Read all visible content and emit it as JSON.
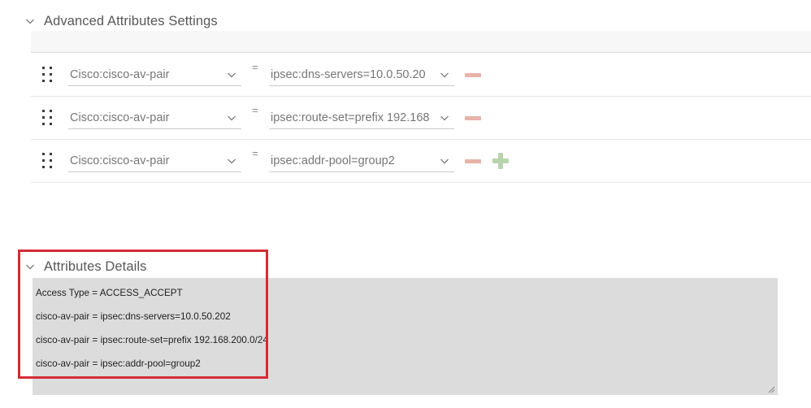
{
  "advanced_section": {
    "title": "Advanced Attributes Settings",
    "chevron_icon": "chevron-down-icon",
    "equals_symbol": "=",
    "rows": [
      {
        "drag_icon": "drag-handle-icon",
        "name": "Cisco:cisco-av-pair",
        "value": "ipsec:dns-servers=10.0.50.20",
        "remove_icon": "minus-icon",
        "add_icon": null
      },
      {
        "drag_icon": "drag-handle-icon",
        "name": "Cisco:cisco-av-pair",
        "value": "ipsec:route-set=prefix 192.168",
        "remove_icon": "minus-icon",
        "add_icon": null
      },
      {
        "drag_icon": "drag-handle-icon",
        "name": "Cisco:cisco-av-pair",
        "value": "ipsec:addr-pool=group2",
        "remove_icon": "minus-icon",
        "add_icon": "plus-icon"
      }
    ]
  },
  "details_section": {
    "title": "Attributes Details",
    "chevron_icon": "chevron-down-icon",
    "lines": [
      "Access Type = ACCESS_ACCEPT",
      "cisco-av-pair = ipsec:dns-servers=10.0.50.202",
      "cisco-av-pair = ipsec:route-set=prefix 192.168.200.0/24",
      "cisco-av-pair = ipsec:addr-pool=group2"
    ],
    "resize_icon": "resize-grip-icon"
  },
  "annotation": {
    "highlight_color": "#d62b36"
  },
  "colors": {
    "minus": "#e8b2a8",
    "plus": "#b9d4ad",
    "details_bg": "#dcdcdc",
    "toolbar_bg": "#f7f7f7",
    "text": "#58585b"
  }
}
